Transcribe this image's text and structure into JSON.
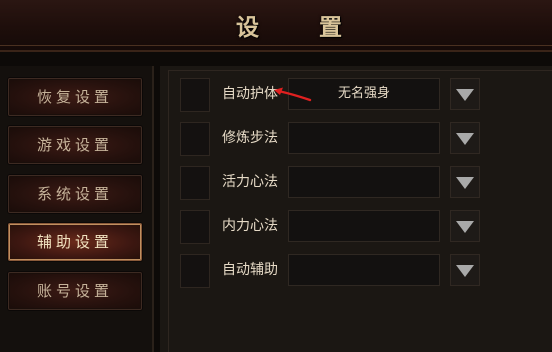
{
  "title": "设 置",
  "sidebar": {
    "items": [
      {
        "label": "恢复设置",
        "active": false
      },
      {
        "label": "游戏设置",
        "active": false
      },
      {
        "label": "系统设置",
        "active": false
      },
      {
        "label": "辅助设置",
        "active": true
      },
      {
        "label": "账号设置",
        "active": false
      }
    ]
  },
  "settings": {
    "rows": [
      {
        "label": "自动护体",
        "value": "无名强身"
      },
      {
        "label": "修炼步法",
        "value": ""
      },
      {
        "label": "活力心法",
        "value": ""
      },
      {
        "label": "内力心法",
        "value": ""
      },
      {
        "label": "自动辅助",
        "value": ""
      }
    ]
  },
  "colors": {
    "annotation_arrow": "#e02020"
  },
  "icons": {
    "dropdown": "triangle-down-icon",
    "annotation": "red-arrow-annotation"
  }
}
